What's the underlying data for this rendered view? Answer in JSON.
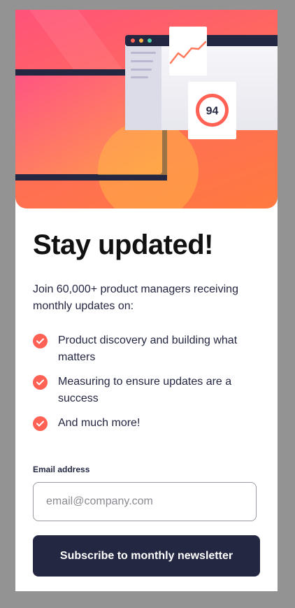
{
  "title": "Stay updated!",
  "intro": "Join 60,000+ product managers receiving monthly updates on:",
  "features": [
    "Product discovery and building what matters",
    "Measuring to ensure updates are a success",
    "And much more!"
  ],
  "email": {
    "label": "Email address",
    "placeholder": "email@company.com",
    "value": ""
  },
  "subscribe_label": "Subscribe to monthly newsletter",
  "illustration": {
    "score": "94"
  },
  "colors": {
    "accent": "#ff6155",
    "dark": "#242742",
    "background": "#939393"
  }
}
